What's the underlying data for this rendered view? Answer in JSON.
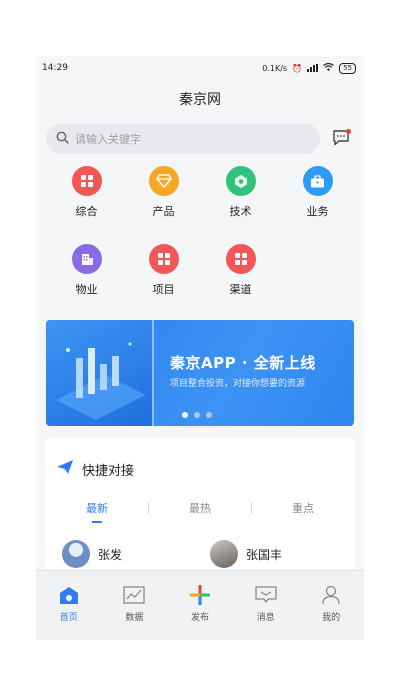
{
  "status": {
    "time": "14:29",
    "speed": "0.1K/s",
    "battery": "55"
  },
  "header": {
    "title": "秦京网"
  },
  "search": {
    "placeholder": "请输入关键字"
  },
  "categories": [
    {
      "label": "综合",
      "icon": "grid-icon",
      "color": "#f25757"
    },
    {
      "label": "产品",
      "icon": "diamond-icon",
      "color": "#f5a623"
    },
    {
      "label": "技术",
      "icon": "tech-icon",
      "color": "#31c27c"
    },
    {
      "label": "业务",
      "icon": "briefcase-icon",
      "color": "#2d9cf5"
    },
    {
      "label": "物业",
      "icon": "building-icon",
      "color": "#8a6ae6"
    },
    {
      "label": "项目",
      "icon": "grid-icon",
      "color": "#f25757"
    },
    {
      "label": "渠道",
      "icon": "grid-icon",
      "color": "#f25757"
    }
  ],
  "banner": {
    "title": "秦京APP · 全新上线",
    "subtitle": "项目整合投资，对接你想要的资源",
    "active_slide": 1,
    "total_slides": 3
  },
  "quick": {
    "title": "快捷对接",
    "tabs": [
      "最新",
      "最热",
      "重点"
    ],
    "active_tab": 0,
    "people": [
      {
        "name": "张发"
      },
      {
        "name": "张国丰"
      }
    ]
  },
  "nav": [
    {
      "label": "首页",
      "icon": "home-icon",
      "active": true
    },
    {
      "label": "数据",
      "icon": "chart-icon",
      "active": false
    },
    {
      "label": "发布",
      "icon": "plus-icon",
      "active": false
    },
    {
      "label": "消息",
      "icon": "message-icon",
      "active": false
    },
    {
      "label": "我的",
      "icon": "user-icon",
      "active": false
    }
  ],
  "colors": {
    "accent": "#2d7ef0",
    "banner": "#2f86ef"
  }
}
